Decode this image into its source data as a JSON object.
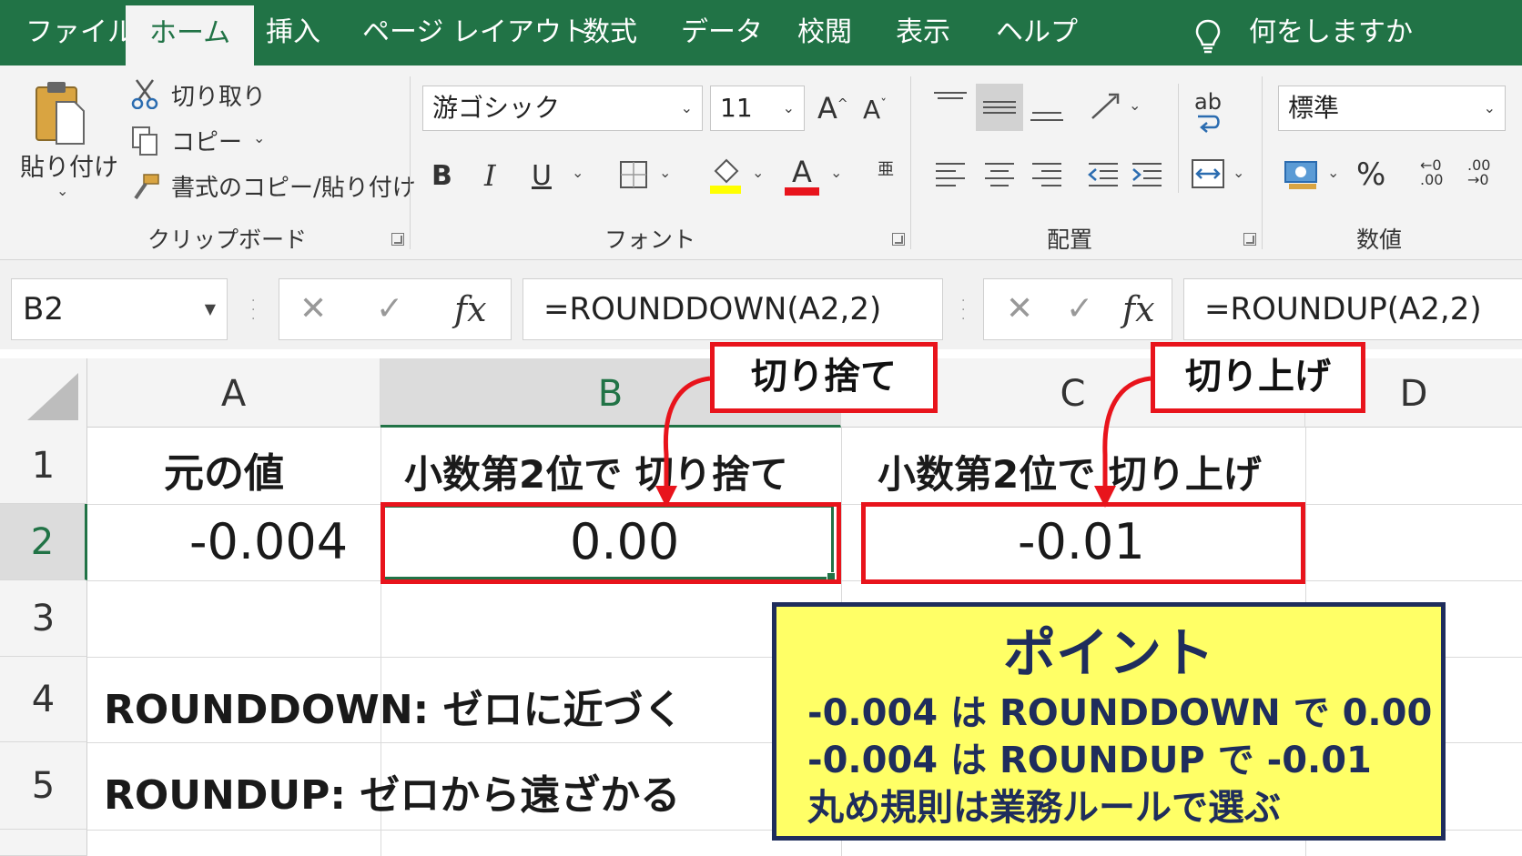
{
  "menu": {
    "tabs": [
      "ファイル",
      "ホーム",
      "挿入",
      "ページ レイアウト",
      "数式",
      "データ",
      "校閲",
      "表示",
      "ヘルプ"
    ],
    "active_tab": "ホーム",
    "tell_me": "何をしますか"
  },
  "ribbon": {
    "clipboard": {
      "paste": "貼り付け",
      "cut": "切り取り",
      "copy": "コピー",
      "format_painter": "書式のコピー/貼り付け",
      "label": "クリップボード"
    },
    "font": {
      "font_name": "游ゴシック",
      "font_size": "11",
      "grow": "A",
      "shrink": "A",
      "bold": "B",
      "italic": "I",
      "underline": "U",
      "font_color_glyph": "A",
      "phonetic": "亜",
      "label": "フォント",
      "fill_color": "#ffff00",
      "font_color": "#e8141c"
    },
    "alignment": {
      "wrap": "ab",
      "label": "配置"
    },
    "number": {
      "format": "標準",
      "percent": "%",
      "inc": ".00",
      "dec": ".00",
      "label": "数値"
    }
  },
  "formula_bar": {
    "name_box": "B2",
    "formula_left": "=ROUNDDOWN(A2,2)",
    "formula_right": "=ROUNDUP(A2,2)",
    "cancel": "✕",
    "enter": "✓",
    "fx": "fx"
  },
  "grid": {
    "columns": [
      "A",
      "B",
      "C",
      "D"
    ],
    "selected_column": "B",
    "rows": [
      "1",
      "2",
      "3",
      "4",
      "5"
    ],
    "selected_row": "2",
    "cells": {
      "A1": "元の値",
      "B1": "小数第2位で 切り捨て",
      "C1": "小数第2位で 切り上げ",
      "A2": "-0.004",
      "B2": "0.00",
      "C2": "-0.01",
      "A4": "ROUNDDOWN: ゼロに近づく",
      "A5": "ROUNDUP: ゼロから遠ざかる"
    }
  },
  "annotations": {
    "callout_down": "切り捨て",
    "callout_up": "切り上げ",
    "point": {
      "title": "ポイント",
      "lines": [
        "-0.004 は ROUNDDOWN で 0.00",
        "-0.004 は ROUNDUP で -0.01",
        "丸め規則は業務ルールで選ぶ"
      ]
    },
    "colors": {
      "highlight": "#e8141c",
      "point_bg": "#ffff66",
      "point_border": "#1f2d5c",
      "excel_green": "#217346"
    }
  }
}
